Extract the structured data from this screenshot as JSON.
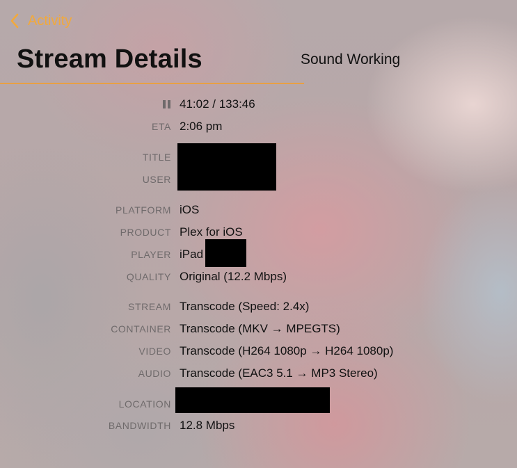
{
  "nav": {
    "back_label": "Activity"
  },
  "header": {
    "title": "Stream Details",
    "side_title": "Sound Working"
  },
  "playback": {
    "progress": "41:02 / 133:46"
  },
  "details": {
    "eta": {
      "label": "ETA",
      "value": "2:06 pm"
    },
    "title": {
      "label": "TITLE"
    },
    "user": {
      "label": "USER"
    },
    "platform": {
      "label": "PLATFORM",
      "value": "iOS"
    },
    "product": {
      "label": "PRODUCT",
      "value": "Plex for iOS"
    },
    "player": {
      "label": "PLAYER",
      "value": "iPad"
    },
    "quality": {
      "label": "QUALITY",
      "value": "Original (12.2 Mbps)"
    },
    "stream": {
      "label": "STREAM",
      "value": "Transcode (Speed: 2.4x)"
    },
    "container": {
      "label": "CONTAINER",
      "value": "Transcode (MKV → MPEGTS)"
    },
    "video": {
      "label": "VIDEO",
      "value": "Transcode (H264 1080p → H264 1080p)"
    },
    "audio": {
      "label": "AUDIO",
      "value": "Transcode (EAC3 5.1 → MP3 Stereo)"
    },
    "location": {
      "label": "LOCATION"
    },
    "bandwidth": {
      "label": "BANDWIDTH",
      "value": "12.8 Mbps"
    }
  },
  "colors": {
    "accent": "#f2a93b",
    "label": "#6f6a6b",
    "text": "#111111",
    "redaction": "#000000"
  }
}
